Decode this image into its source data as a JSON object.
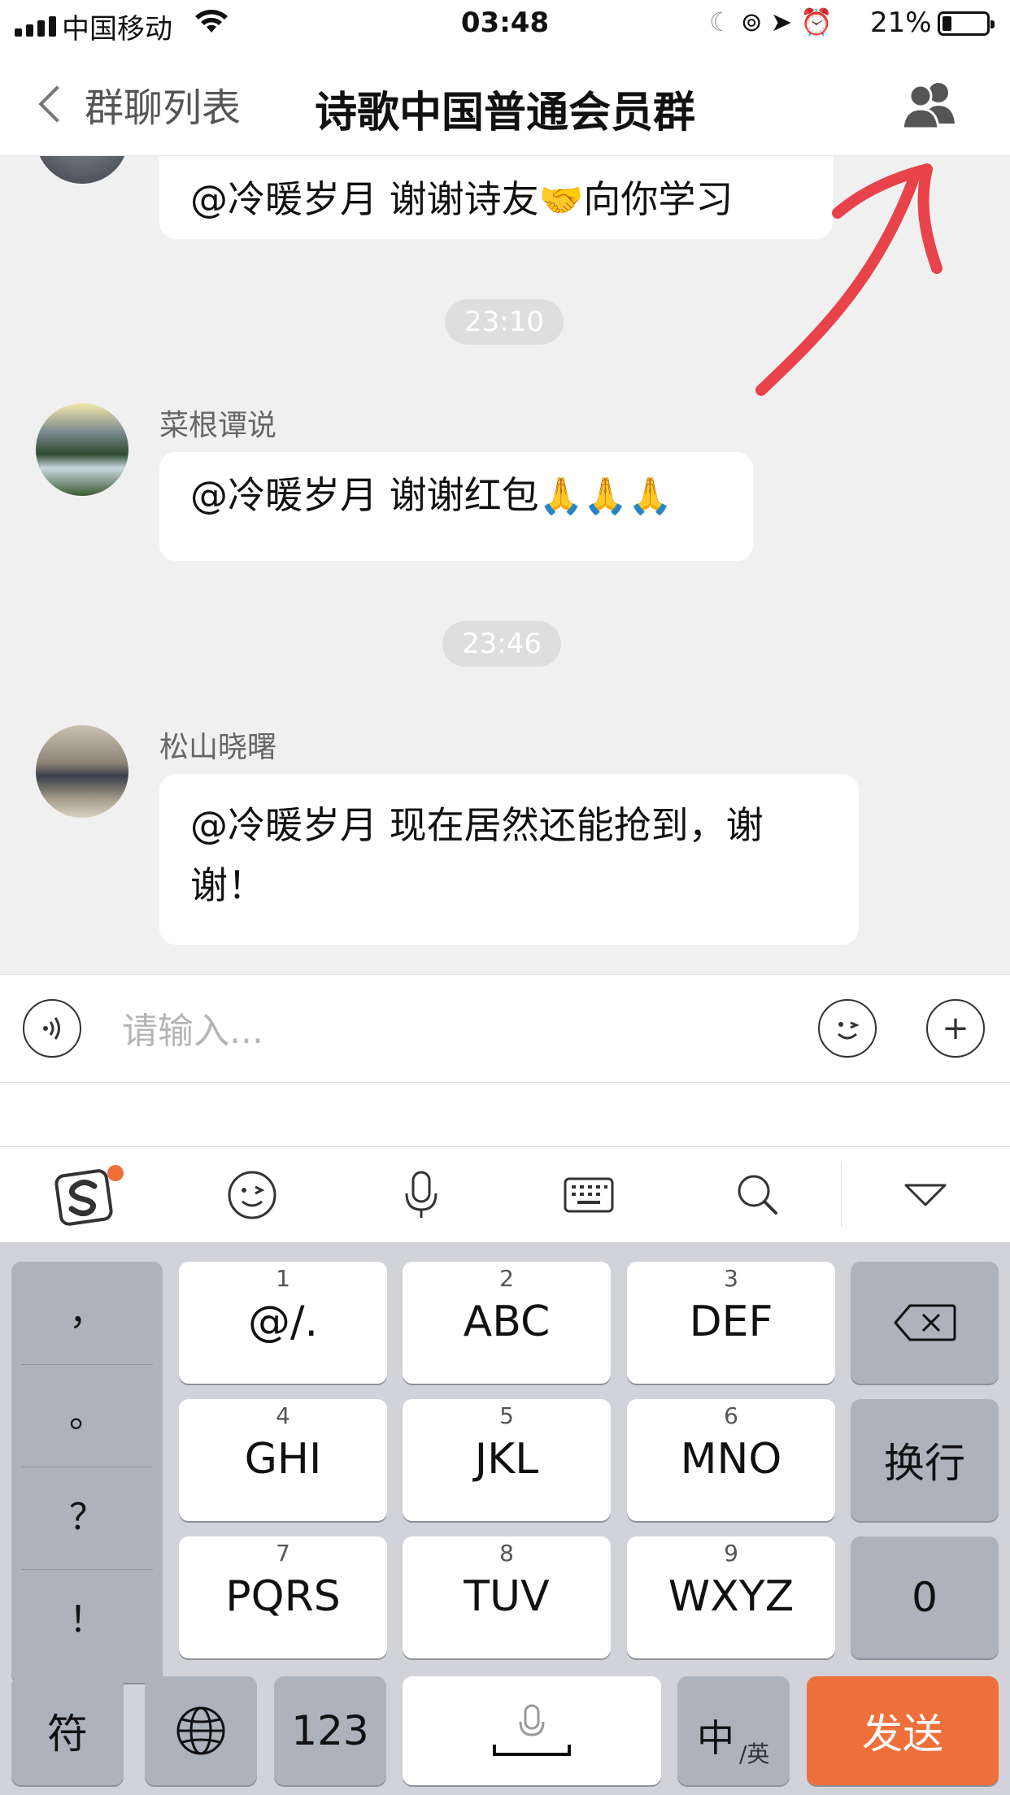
{
  "status_bar": {
    "carrier": "中国移动",
    "time": "03:48",
    "battery": "21%",
    "battery_level": 0.21
  },
  "nav": {
    "back_label": "群聊列表",
    "title": "诗歌中国普通会员群",
    "members_icon": "group-members-icon"
  },
  "messages": [
    {
      "sender": "",
      "text_pre": "@冷暖岁月  谢谢诗友",
      "emoji": "🤝",
      "text_post": "向你学习"
    },
    {
      "time": "23:10"
    },
    {
      "sender": "菜根谭说",
      "text_pre": "@冷暖岁月 谢谢红包",
      "emoji": "🙏🙏🙏",
      "text_post": ""
    },
    {
      "time": "23:46"
    },
    {
      "sender": "松山晓曙",
      "text_pre": "@冷暖岁月 现在居然还能抢到，谢谢！",
      "emoji": "",
      "text_post": ""
    }
  ],
  "input": {
    "placeholder": "请输入..."
  },
  "ime_toolbar": {
    "icons": [
      "sogou-logo-icon",
      "emoji-face-icon",
      "microphone-icon",
      "keyboard-icon",
      "search-icon",
      "collapse-triangle-icon"
    ]
  },
  "keyboard": {
    "punct": [
      "，",
      "。",
      "？",
      "！"
    ],
    "keys": [
      {
        "num": "1",
        "label": "@/."
      },
      {
        "num": "2",
        "label": "ABC"
      },
      {
        "num": "3",
        "label": "DEF"
      },
      {
        "num": "4",
        "label": "GHI"
      },
      {
        "num": "5",
        "label": "JKL"
      },
      {
        "num": "6",
        "label": "MNO"
      },
      {
        "num": "7",
        "label": "PQRS"
      },
      {
        "num": "8",
        "label": "TUV"
      },
      {
        "num": "9",
        "label": "WXYZ"
      }
    ],
    "newline": "换行",
    "zero": "0",
    "symbols": "符",
    "numbers": "123",
    "lang_main": "中",
    "lang_sub": "/英",
    "send": "发送"
  },
  "colors": {
    "accent_send": "#ef6f3b",
    "annotation_arrow": "#e8424a"
  }
}
